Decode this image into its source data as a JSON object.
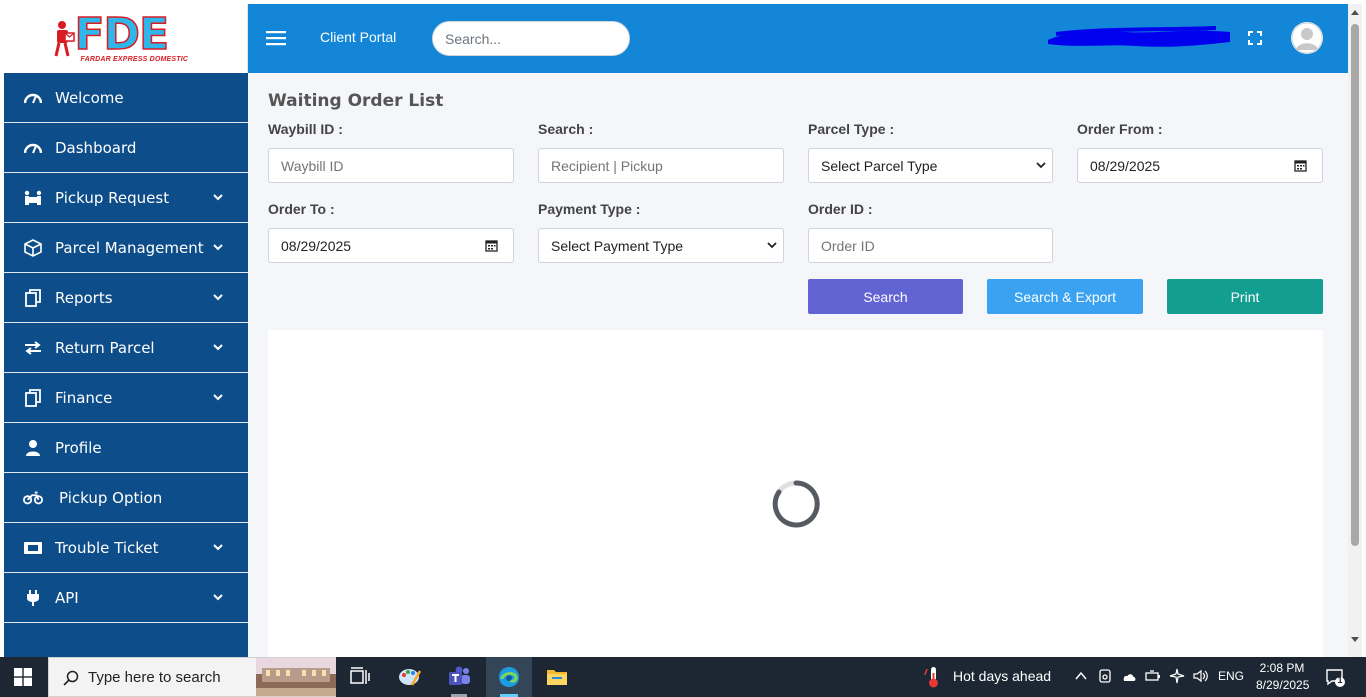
{
  "logo": {
    "text": "FDE",
    "tagline": "FARDAR EXPRESS DOMESTIC"
  },
  "sidebar": {
    "items": [
      {
        "label": "Welcome",
        "icon": "gauge-icon",
        "has_submenu": false
      },
      {
        "label": "Dashboard",
        "icon": "gauge-icon",
        "has_submenu": false
      },
      {
        "label": "Pickup Request",
        "icon": "people-carry-icon",
        "has_submenu": true
      },
      {
        "label": "Parcel Management",
        "icon": "box-icon",
        "has_submenu": true
      },
      {
        "label": "Reports",
        "icon": "copy-icon",
        "has_submenu": true
      },
      {
        "label": "Return Parcel",
        "icon": "exchange-icon",
        "has_submenu": true
      },
      {
        "label": "Finance",
        "icon": "copy-icon",
        "has_submenu": true
      },
      {
        "label": "Profile",
        "icon": "user-icon",
        "has_submenu": false
      },
      {
        "label": "Pickup Option",
        "icon": "motorcycle-icon",
        "has_submenu": false
      },
      {
        "label": "Trouble Ticket",
        "icon": "ticket-icon",
        "has_submenu": true
      },
      {
        "label": "API",
        "icon": "plug-icon",
        "has_submenu": true
      }
    ]
  },
  "header": {
    "brand": "Client Portal",
    "search_placeholder": "Search...",
    "colors": {
      "header_bg": "#1486d8",
      "sidebar_bg": "#0d4d8a"
    }
  },
  "page": {
    "title": "Waiting Order List",
    "filters": {
      "waybill": {
        "label": "Waybill ID :",
        "placeholder": "Waybill ID"
      },
      "search": {
        "label": "Search :",
        "placeholder": "Recipient | Pickup"
      },
      "parcel_type": {
        "label": "Parcel Type :",
        "value": "Select Parcel Type"
      },
      "order_from": {
        "label": "Order From :",
        "value": "08/29/2025"
      },
      "order_to": {
        "label": "Order To :",
        "value": "08/29/2025"
      },
      "payment_type": {
        "label": "Payment Type :",
        "value": "Select Payment Type"
      },
      "order_id": {
        "label": "Order ID :",
        "placeholder": "Order ID"
      }
    },
    "buttons": {
      "search": {
        "label": "Search",
        "color": "#6264d4"
      },
      "search_export": {
        "label": "Search & Export",
        "color": "#3aa2f0"
      },
      "print": {
        "label": "Print",
        "color": "#129e91"
      }
    },
    "loading": true
  },
  "taskbar": {
    "search_placeholder": "Type here to search",
    "weather": "Hot days ahead",
    "language": "ENG",
    "time": "2:08 PM",
    "date": "8/29/2025",
    "notification_count": "1",
    "apps": [
      "task-view-icon",
      "paint-icon",
      "teams-icon",
      "edge-icon",
      "file-explorer-icon"
    ]
  }
}
